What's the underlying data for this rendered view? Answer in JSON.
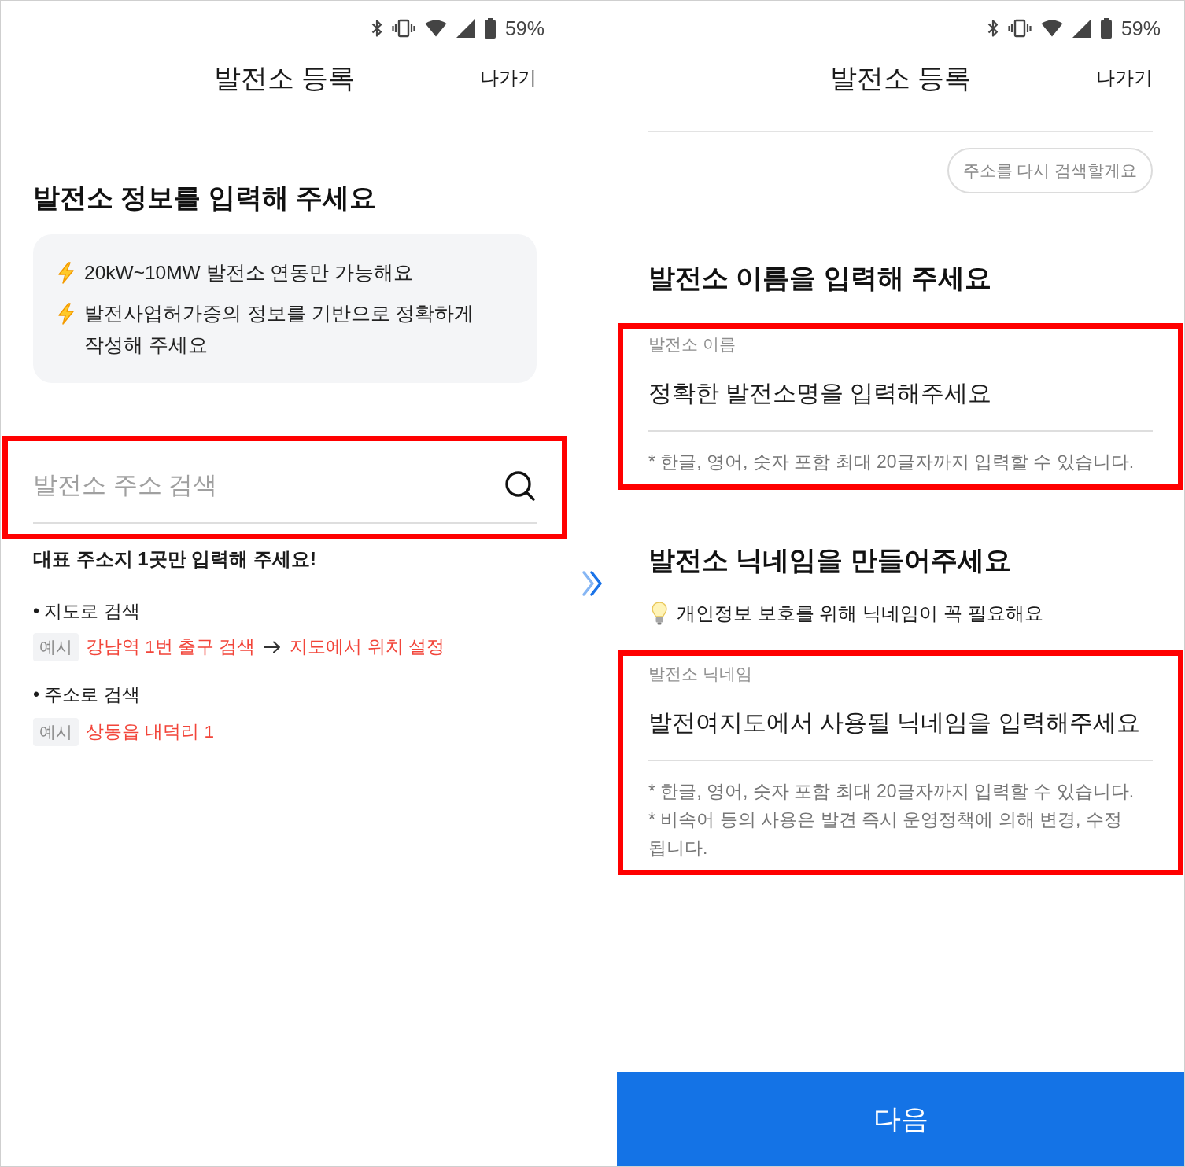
{
  "address_screen": {
    "status_bar": {
      "battery": "59%"
    },
    "header": {
      "title": "발전소 등록",
      "exit": "나가기"
    },
    "heading": "발전소 정보를 입력해 주세요",
    "notices": [
      "20kW~10MW 발전소 연동만 가능해요",
      "발전사업허가증의 정보를 기반으로 정확하게 작성해 주세요"
    ],
    "search": {
      "placeholder": "발전소 주소 검색",
      "highlighted": true
    },
    "guide_title": "대표 주소지 1곳만 입력해 주세요!",
    "methods": [
      {
        "label": "• 지도로 검색",
        "example_tag": "예시",
        "example_steps": [
          "강남역 1번 출구 검색",
          "지도에서 위치 설정"
        ]
      },
      {
        "label": "• 주소로 검색",
        "example_tag": "예시",
        "example_steps": [
          "상동읍 내덕리 1"
        ]
      }
    ]
  },
  "name_screen": {
    "status_bar": {
      "battery": "59%"
    },
    "header": {
      "title": "발전소 등록",
      "exit": "나가기"
    },
    "search_again_button": "주소를 다시 검색할게요",
    "sections": [
      {
        "heading": "발전소 이름을 입력해 주세요",
        "field": {
          "label": "발전소 이름",
          "placeholder": "정확한 발전소명을 입력해주세요",
          "highlighted": true,
          "hints": [
            "* 한글, 영어, 숫자 포함 최대 20글자까지 입력할 수 있습니다."
          ]
        }
      },
      {
        "heading": "발전소 닉네임을 만들어주세요",
        "tip": "개인정보 보호를 위해 닉네임이 꼭 필요해요",
        "field": {
          "label": "발전소 닉네임",
          "placeholder": "발전여지도에서 사용될 닉네임을 입력해주세요",
          "highlighted": true,
          "hints": [
            "* 한글, 영어, 숫자 포함 최대 20글자까지 입력할 수 있습니다.",
            "* 비속어 등의 사용은 발견 즉시 운영정책에 의해 변경, 수정 됩니다."
          ]
        }
      }
    ],
    "next_button": "다음"
  }
}
